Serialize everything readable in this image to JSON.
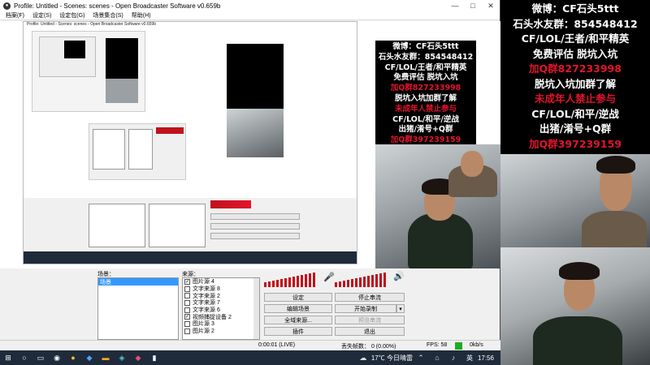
{
  "window": {
    "title": "Profile: Untitled - Scenes: scenes - Open Broadcaster Software v0.659b",
    "minimize": "—",
    "maximize": "□",
    "close": "✕"
  },
  "menu": [
    "档案(F)",
    "设定(S)",
    "设定包(G)",
    "场景集合(S)",
    "帮助(H)"
  ],
  "nested_title": "Profile: Untitled - Scenes: scenes - Open Broadcaster Software v0.659b",
  "promo": {
    "line1": "微博：CF石头5ttt",
    "line2": "石头水友群：854548412",
    "line3": "CF/LOL/王者/和平精英",
    "line4": "免费评估 脱坑入坑",
    "line5": "加Q群827233998",
    "line6": "脱坑入坑加群了解",
    "line7": "未成年人禁止参与",
    "line8": "CF/LOL/和平/逆战",
    "line9": "出猪/淆号+Q群",
    "line10": "加Q群397239159"
  },
  "docks": {
    "scenes_label": "场景：",
    "sources_label": "来源：",
    "scenes": [
      "场景"
    ],
    "sources": [
      {
        "name": "图片源 4",
        "checked": true
      },
      {
        "name": "文字来源 8",
        "checked": false
      },
      {
        "name": "文字来源 2",
        "checked": false
      },
      {
        "name": "文字来源 7",
        "checked": false
      },
      {
        "name": "文字来源 6",
        "checked": false
      },
      {
        "name": "视频捕捉设备 2",
        "checked": true
      },
      {
        "name": "图片源 3",
        "checked": false
      },
      {
        "name": "图片源 2",
        "checked": false
      }
    ]
  },
  "controls": {
    "settings": "设定",
    "stop_stream": "停止串流",
    "edit_scene": "编辑场景",
    "start_record": "开始录制",
    "global_source": "全域来源...",
    "preview_stream": "预览串流",
    "plugins": "插件",
    "exit": "退出"
  },
  "status": {
    "time": "0:00:01 (LIVE)",
    "dropped": "丢失帧数： 0 (0.00%)",
    "fps": "FPS: 58",
    "bitrate": "0kb/s"
  },
  "taskbar": {
    "weather": "17℃ 今日晴雷",
    "clock": "17:56",
    "ime": "英"
  },
  "colors": {
    "accent_red": "#e2142c",
    "selection_blue": "#3399ff",
    "taskbar": "#1f2b3a"
  }
}
